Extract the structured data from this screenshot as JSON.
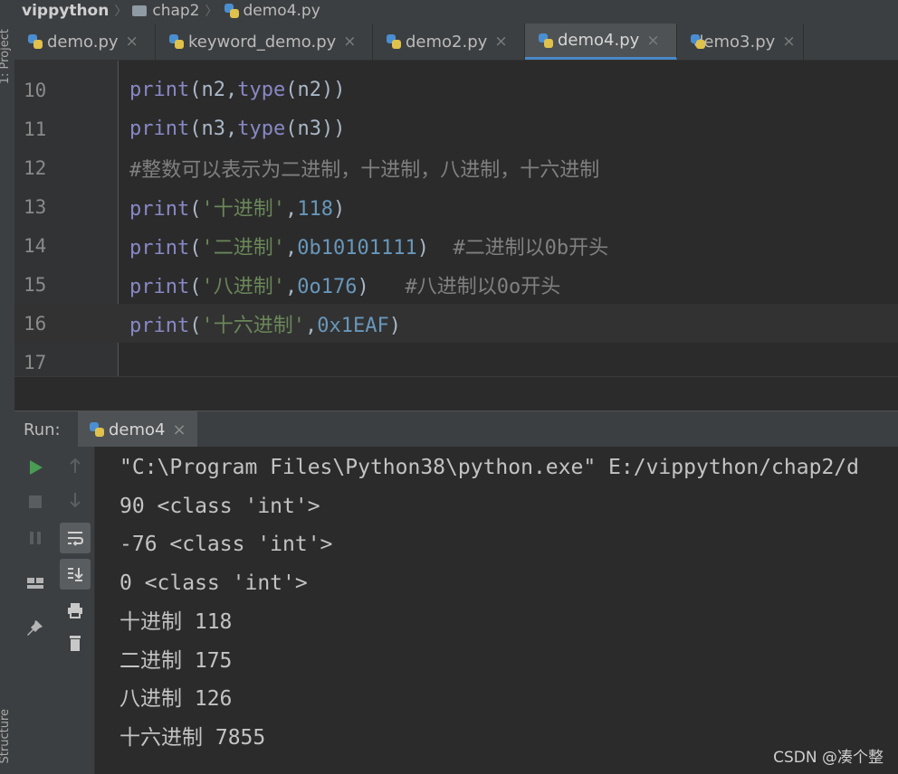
{
  "breadcrumb": {
    "project": "vippython",
    "folder": "chap2",
    "file": "demo4.py"
  },
  "left_strip": {
    "project_label": "1: Project",
    "structure_label": "Structure"
  },
  "tabs": [
    {
      "label": "demo.py",
      "active": false
    },
    {
      "label": "keyword_demo.py",
      "active": false
    },
    {
      "label": "demo2.py",
      "active": false
    },
    {
      "label": "demo4.py",
      "active": true
    },
    {
      "label": "demo3.py",
      "active": false
    }
  ],
  "tab_close_glyph": "×",
  "editor": {
    "current_line": 16,
    "lines": [
      {
        "num": "10",
        "tokens": [
          [
            "fn",
            "print"
          ],
          [
            "pun",
            "("
          ],
          [
            "nm",
            "n2"
          ],
          [
            "pun",
            ","
          ],
          [
            "fn",
            "type"
          ],
          [
            "pun",
            "("
          ],
          [
            "nm",
            "n2"
          ],
          [
            "pun",
            "))"
          ]
        ]
      },
      {
        "num": "11",
        "tokens": [
          [
            "fn",
            "print"
          ],
          [
            "pun",
            "("
          ],
          [
            "nm",
            "n3"
          ],
          [
            "pun",
            ","
          ],
          [
            "fn",
            "type"
          ],
          [
            "pun",
            "("
          ],
          [
            "nm",
            "n3"
          ],
          [
            "pun",
            "))"
          ]
        ]
      },
      {
        "num": "12",
        "tokens": [
          [
            "cmt",
            "#整数可以表示为二进制，十进制，八进制，十六进制"
          ]
        ]
      },
      {
        "num": "13",
        "tokens": [
          [
            "fn",
            "print"
          ],
          [
            "pun",
            "("
          ],
          [
            "str",
            "'十进制'"
          ],
          [
            "pun",
            ","
          ],
          [
            "num",
            "118"
          ],
          [
            "pun",
            ")"
          ]
        ]
      },
      {
        "num": "14",
        "tokens": [
          [
            "fn",
            "print"
          ],
          [
            "pun",
            "("
          ],
          [
            "str",
            "'二进制'"
          ],
          [
            "pun",
            ","
          ],
          [
            "num",
            "0b10101111"
          ],
          [
            "pun",
            ")  "
          ],
          [
            "cmt",
            "#二进制以0b开头"
          ]
        ]
      },
      {
        "num": "15",
        "tokens": [
          [
            "fn",
            "print"
          ],
          [
            "pun",
            "("
          ],
          [
            "str",
            "'八进制'"
          ],
          [
            "pun",
            ","
          ],
          [
            "num",
            "0o176"
          ],
          [
            "pun",
            ")   "
          ],
          [
            "cmt",
            "#八进制以0o开头"
          ]
        ]
      },
      {
        "num": "16",
        "tokens": [
          [
            "fn",
            "print"
          ],
          [
            "pun",
            "("
          ],
          [
            "str",
            "'十六进制'"
          ],
          [
            "pun",
            ","
          ],
          [
            "num",
            "0x1EAF"
          ],
          [
            "pun",
            ")"
          ]
        ]
      },
      {
        "num": "17",
        "tokens": []
      }
    ]
  },
  "run_panel": {
    "label": "Run:",
    "tab_label": "demo4",
    "output": [
      "\"C:\\Program Files\\Python38\\python.exe\" E:/vippython/chap2/d",
      "90 <class 'int'>",
      "-76 <class 'int'>",
      "0 <class 'int'>",
      "十进制 118",
      "二进制 175",
      "八进制 126",
      "十六进制 7855"
    ]
  },
  "watermark": "CSDN @凑个整",
  "colors": {
    "accent": "#4a88c7",
    "run_green": "#499c54"
  }
}
